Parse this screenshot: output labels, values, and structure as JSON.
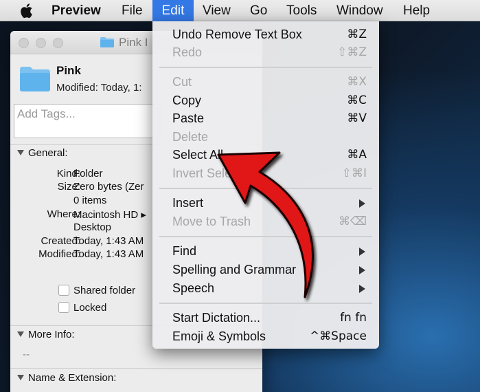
{
  "menubar": {
    "app_name": "Preview",
    "menus": [
      "File",
      "Edit",
      "View",
      "Go",
      "Tools",
      "Window",
      "Help"
    ],
    "active_menu": "Edit"
  },
  "info_window": {
    "title": "Pink I",
    "name": "Pink",
    "modified_line": "Modified: Today, 1:",
    "tags_placeholder": "Add Tags...",
    "general_header": "General:",
    "fields": [
      {
        "label": "Kind:",
        "value": "Folder"
      },
      {
        "label": "Size:",
        "value": "Zero bytes (Zer"
      },
      {
        "label": "",
        "value": "0 items"
      },
      {
        "label": "Where:",
        "value": "Macintosh HD ▸"
      },
      {
        "label": "",
        "value": "Desktop"
      },
      {
        "label": "Created:",
        "value": "Today, 1:43 AM"
      },
      {
        "label": "Modified:",
        "value": "Today, 1:43 AM"
      }
    ],
    "shared_folder_label": "Shared folder",
    "locked_label": "Locked",
    "more_info_header": "More Info:",
    "more_info_value": "--",
    "name_ext_header": "Name & Extension:"
  },
  "edit_menu": {
    "items": [
      {
        "label": "Undo Remove Text Box",
        "shortcut": "⌘Z",
        "enabled": true
      },
      {
        "label": "Redo",
        "shortcut": "⇧⌘Z",
        "enabled": false
      },
      {
        "label": "Cut",
        "shortcut": "⌘X",
        "enabled": false
      },
      {
        "label": "Copy",
        "shortcut": "⌘C",
        "enabled": true
      },
      {
        "label": "Paste",
        "shortcut": "⌘V",
        "enabled": true
      },
      {
        "label": "Delete",
        "shortcut": "",
        "enabled": false
      },
      {
        "label": "Select All",
        "shortcut": "⌘A",
        "enabled": true
      },
      {
        "label": "Invert Selection",
        "shortcut": "⇧⌘I",
        "enabled": false
      },
      {
        "label": "Insert",
        "shortcut": "",
        "enabled": true,
        "submenu": true
      },
      {
        "label": "Move to Trash",
        "shortcut": "⌘⌫",
        "enabled": false
      },
      {
        "label": "Find",
        "shortcut": "",
        "enabled": true,
        "submenu": true
      },
      {
        "label": "Spelling and Grammar",
        "shortcut": "",
        "enabled": true,
        "submenu": true
      },
      {
        "label": "Speech",
        "shortcut": "",
        "enabled": true,
        "submenu": true
      },
      {
        "label": "Start Dictation...",
        "shortcut": "fn fn",
        "enabled": true
      },
      {
        "label": "Emoji & Symbols",
        "shortcut": "^⌘Space",
        "enabled": true
      }
    ]
  },
  "colors": {
    "menu_highlight": "#3478e5",
    "folder_blue": "#5fb3ec",
    "annotation_arrow": "#e11919",
    "disabled_text": "#a6a6a6"
  },
  "icons": [
    "apple-logo-icon",
    "folder-icon",
    "disclosure-triangle-icon",
    "submenu-arrow-icon",
    "red-pointer-arrow"
  ]
}
